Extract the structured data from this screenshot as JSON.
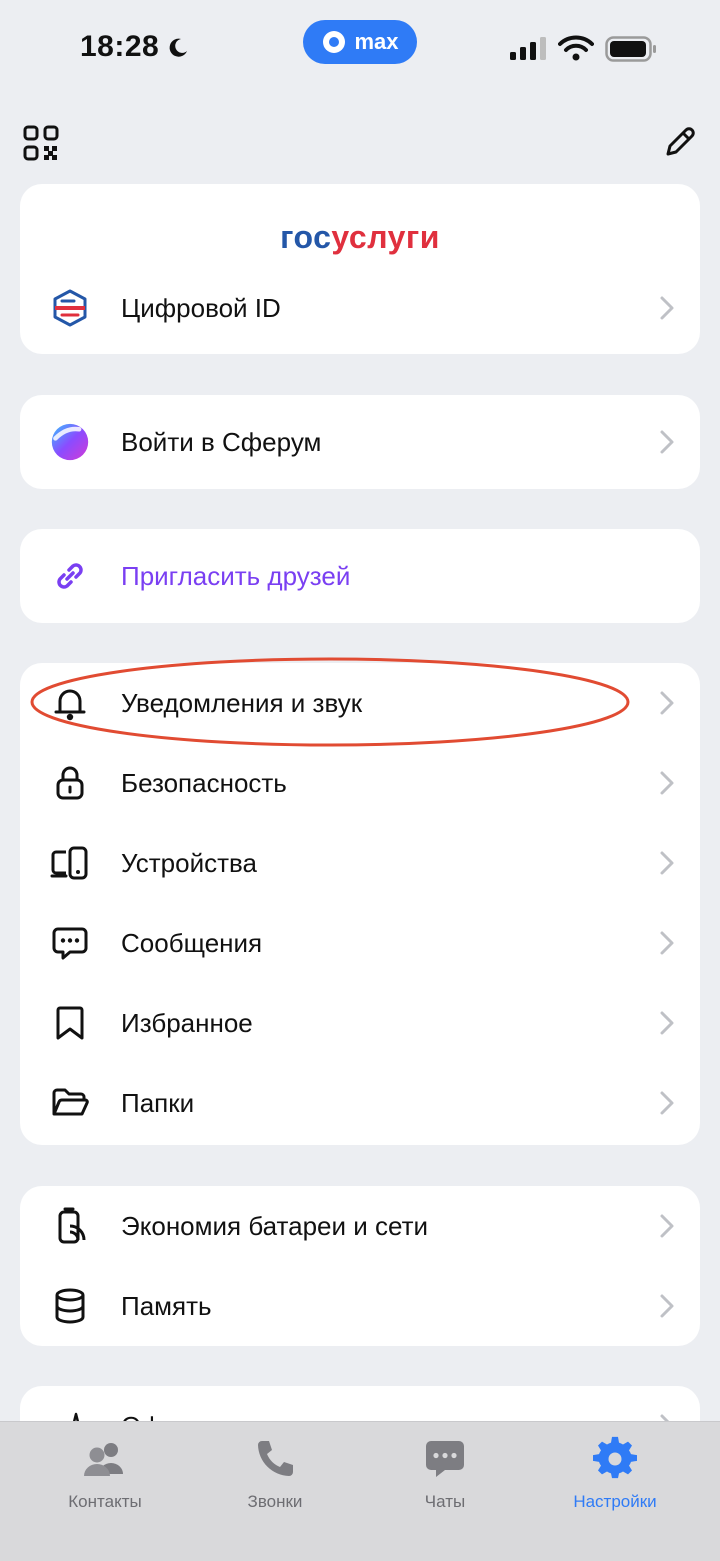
{
  "status_bar": {
    "time": "18:28",
    "app_pill_label": "max"
  },
  "brand": {
    "gos_part1": "гос",
    "gos_part2": "услуги"
  },
  "rows": {
    "digital_id": "Цифровой ID",
    "sferum": "Войти в Сферум",
    "invite": "Пригласить друзей",
    "notifications": "Уведомления и звук",
    "security": "Безопасность",
    "devices": "Устройства",
    "messages": "Сообщения",
    "favorites": "Избранное",
    "folders": "Папки",
    "battery_saver": "Экономия батареи и сети",
    "storage": "Память",
    "appearance": "Оформление"
  },
  "tabs": {
    "contacts": "Контакты",
    "calls": "Звонки",
    "chats": "Чаты",
    "settings": "Настройки"
  },
  "colors": {
    "accent": "#2f7bf6",
    "invite": "#7a3ff2",
    "highlight": "#e14b32",
    "gos_blue": "#2457a8",
    "gos_red": "#e0303e"
  }
}
